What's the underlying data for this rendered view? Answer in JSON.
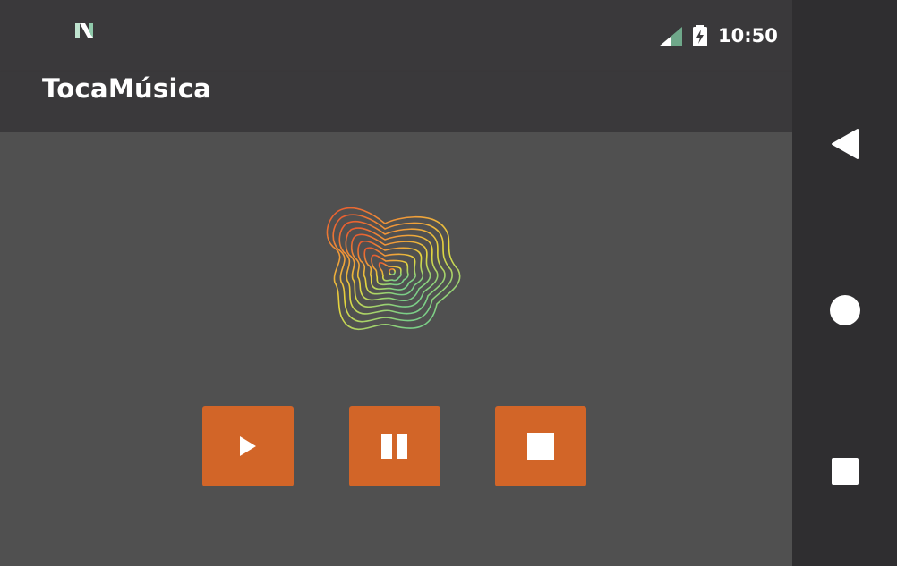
{
  "status_bar": {
    "time": "10:50",
    "notification_icon": "n-logo-icon",
    "signal_icon": "cell-signal-icon",
    "battery_icon": "battery-charging-icon",
    "accent_color": "#7fbf9b"
  },
  "app_bar": {
    "title": "TocaMúsica"
  },
  "content": {
    "artwork_icon": "contour-blob-icon",
    "controls": {
      "play_icon": "play-icon",
      "pause_icon": "pause-icon",
      "stop_icon": "stop-icon",
      "button_color": "#d26528"
    }
  },
  "nav_bar": {
    "back_icon": "back-triangle-icon",
    "home_icon": "home-circle-icon",
    "recents_icon": "recents-square-icon"
  }
}
